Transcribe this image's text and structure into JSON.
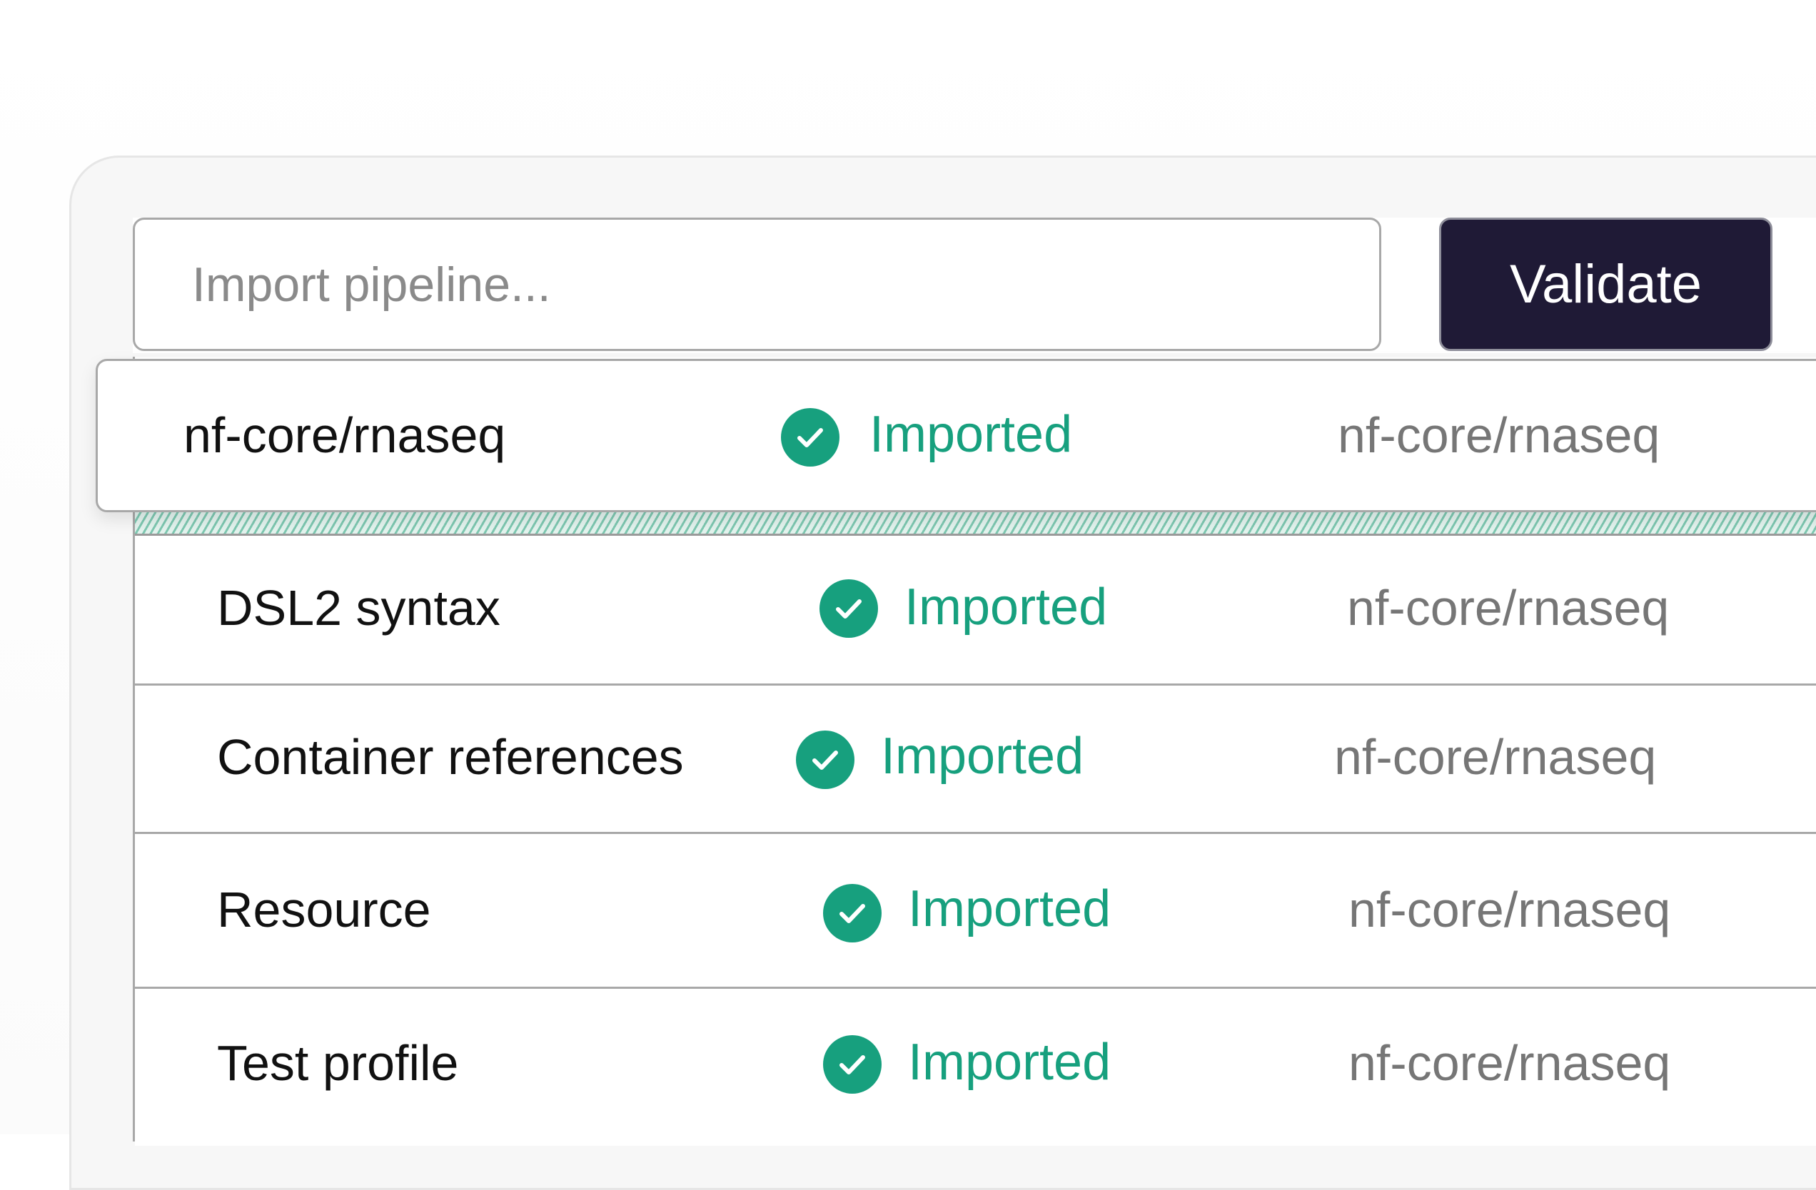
{
  "search": {
    "placeholder": "Import pipeline..."
  },
  "toolbar": {
    "validate_label": "Validate"
  },
  "colors": {
    "accent": "#17a07e",
    "button_bg": "#1f1a36"
  },
  "rows": [
    {
      "name": "nf-core/rnaseq",
      "status": "Imported",
      "source": "nf-core/rnaseq",
      "status_icon": "check-circle-icon"
    },
    {
      "name": "DSL2 syntax",
      "status": "Imported",
      "source": "nf-core/rnaseq",
      "status_icon": "check-circle-icon"
    },
    {
      "name": "Container references",
      "status": "Imported",
      "source": "nf-core/rnaseq",
      "status_icon": "check-circle-icon"
    },
    {
      "name": "Resource",
      "status": "Imported",
      "source": "nf-core/rnaseq",
      "status_icon": "check-circle-icon"
    },
    {
      "name": "Test profile",
      "status": "Imported",
      "source": "nf-core/rnaseq",
      "status_icon": "check-circle-icon"
    }
  ]
}
